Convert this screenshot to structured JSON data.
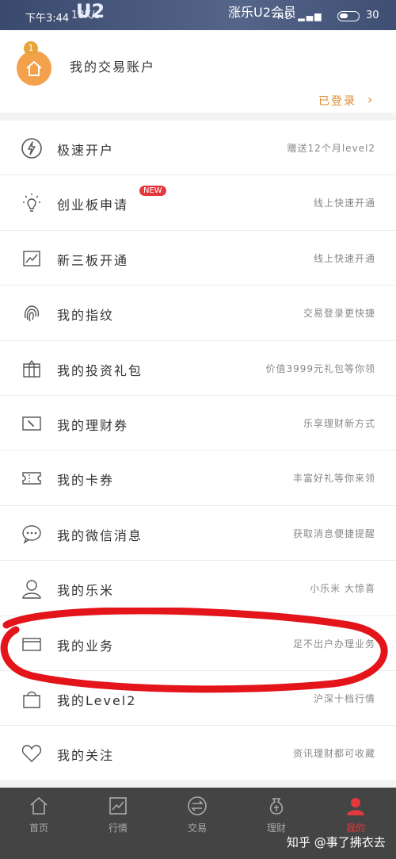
{
  "status_bar": {
    "time": "下午3:44",
    "speed": "18K/s",
    "banner": "涨乐U2会员",
    "banner_logo": "U2",
    "signal": "HD ▂▄▆",
    "battery": "30"
  },
  "account": {
    "level": "1",
    "title": "我的交易账户",
    "login_label": "已登录",
    "arrow": "›"
  },
  "menu": [
    {
      "label": "极速开户",
      "desc": "赠送12个月level2",
      "icon": "lightning-icon"
    },
    {
      "label": "创业板申请",
      "desc": "线上快速开通",
      "icon": "lightbulb-icon",
      "badge": "NEW"
    },
    {
      "label": "新三板开通",
      "desc": "线上快速开通",
      "icon": "chart-icon"
    },
    {
      "label": "我的指纹",
      "desc": "交易登录更快捷",
      "icon": "fingerprint-icon"
    },
    {
      "label": "我的投资礼包",
      "desc": "价值3999元礼包等你领",
      "icon": "gift-icon"
    },
    {
      "label": "我的理财券",
      "desc": "乐享理财新方式",
      "icon": "voucher-icon"
    },
    {
      "label": "我的卡券",
      "desc": "丰富好礼等你来领",
      "icon": "coupon-icon"
    },
    {
      "label": "我的微信消息",
      "desc": "获取消息便捷提醒",
      "icon": "chat-icon"
    },
    {
      "label": "我的乐米",
      "desc": "小乐米 大惊喜",
      "icon": "user-icon"
    },
    {
      "label": "我的业务",
      "desc": "足不出户办理业务",
      "icon": "card-icon"
    },
    {
      "label": "我的Level2",
      "desc": "沪深十档行情",
      "icon": "bag-icon"
    },
    {
      "label": "我的关注",
      "desc": "资讯理财都可收藏",
      "icon": "heart-icon"
    }
  ],
  "tabs": [
    {
      "label": "首页",
      "icon": "home-icon"
    },
    {
      "label": "行情",
      "icon": "market-icon"
    },
    {
      "label": "交易",
      "icon": "trade-icon"
    },
    {
      "label": "理财",
      "icon": "finance-icon"
    },
    {
      "label": "我的",
      "icon": "profile-icon",
      "active": true
    }
  ],
  "watermark": "知乎 @事了拂衣去",
  "colors": {
    "accent": "#e4393c",
    "orange": "#f4a14b",
    "tabbar": "#444444"
  }
}
